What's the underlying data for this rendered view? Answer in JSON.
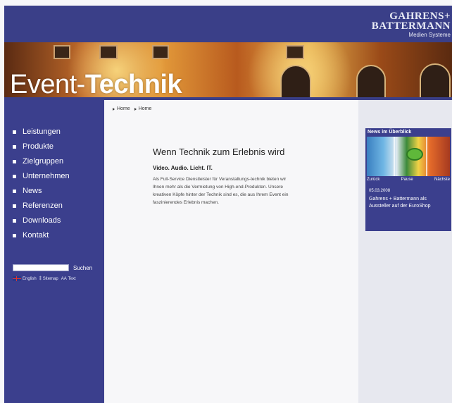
{
  "header": {
    "logo_line1": "GAHRENS+",
    "logo_line2": "BATTERMANN",
    "logo_tagline": "Medien Systeme"
  },
  "hero": {
    "title_part1": "Event-",
    "title_part2": "Technik"
  },
  "nav": {
    "items": [
      {
        "label": "Leistungen"
      },
      {
        "label": "Produkte"
      },
      {
        "label": "Zielgruppen"
      },
      {
        "label": "Unternehmen"
      },
      {
        "label": "News"
      },
      {
        "label": "Referenzen"
      },
      {
        "label": "Downloads"
      },
      {
        "label": "Kontakt"
      }
    ]
  },
  "search": {
    "value": "",
    "button_label": "Suchen"
  },
  "utility": {
    "english": "English",
    "sitemap": "Sitemap",
    "text": "Text"
  },
  "breadcrumb": {
    "items": [
      "Home",
      "Home"
    ]
  },
  "content": {
    "title": "Wenn Technik zum Erlebnis wird",
    "subtitle": "Video. Audio. Licht. IT.",
    "body": "Als Full-Service Dienstleister für Veranstaltungs-technik bieten wir Ihnen mehr als die Vermietung von High-end-Produkten. Unsere kreativen Köpfe hinter der Technik sind es, die aus Ihrem Event ein faszinierendes Erlebnis machen."
  },
  "news": {
    "header": "News im Überblick",
    "prev": "Zurück",
    "pause": "Pause",
    "next": "Nächste",
    "date": "05.03.2008",
    "headline": "Gahrens + Battermann als Aussteller auf der EuroShop"
  },
  "colors": {
    "brand_blue": "#3b3f8d",
    "page_bg": "#f7f7f9",
    "right_column": "#e7e8ef"
  }
}
